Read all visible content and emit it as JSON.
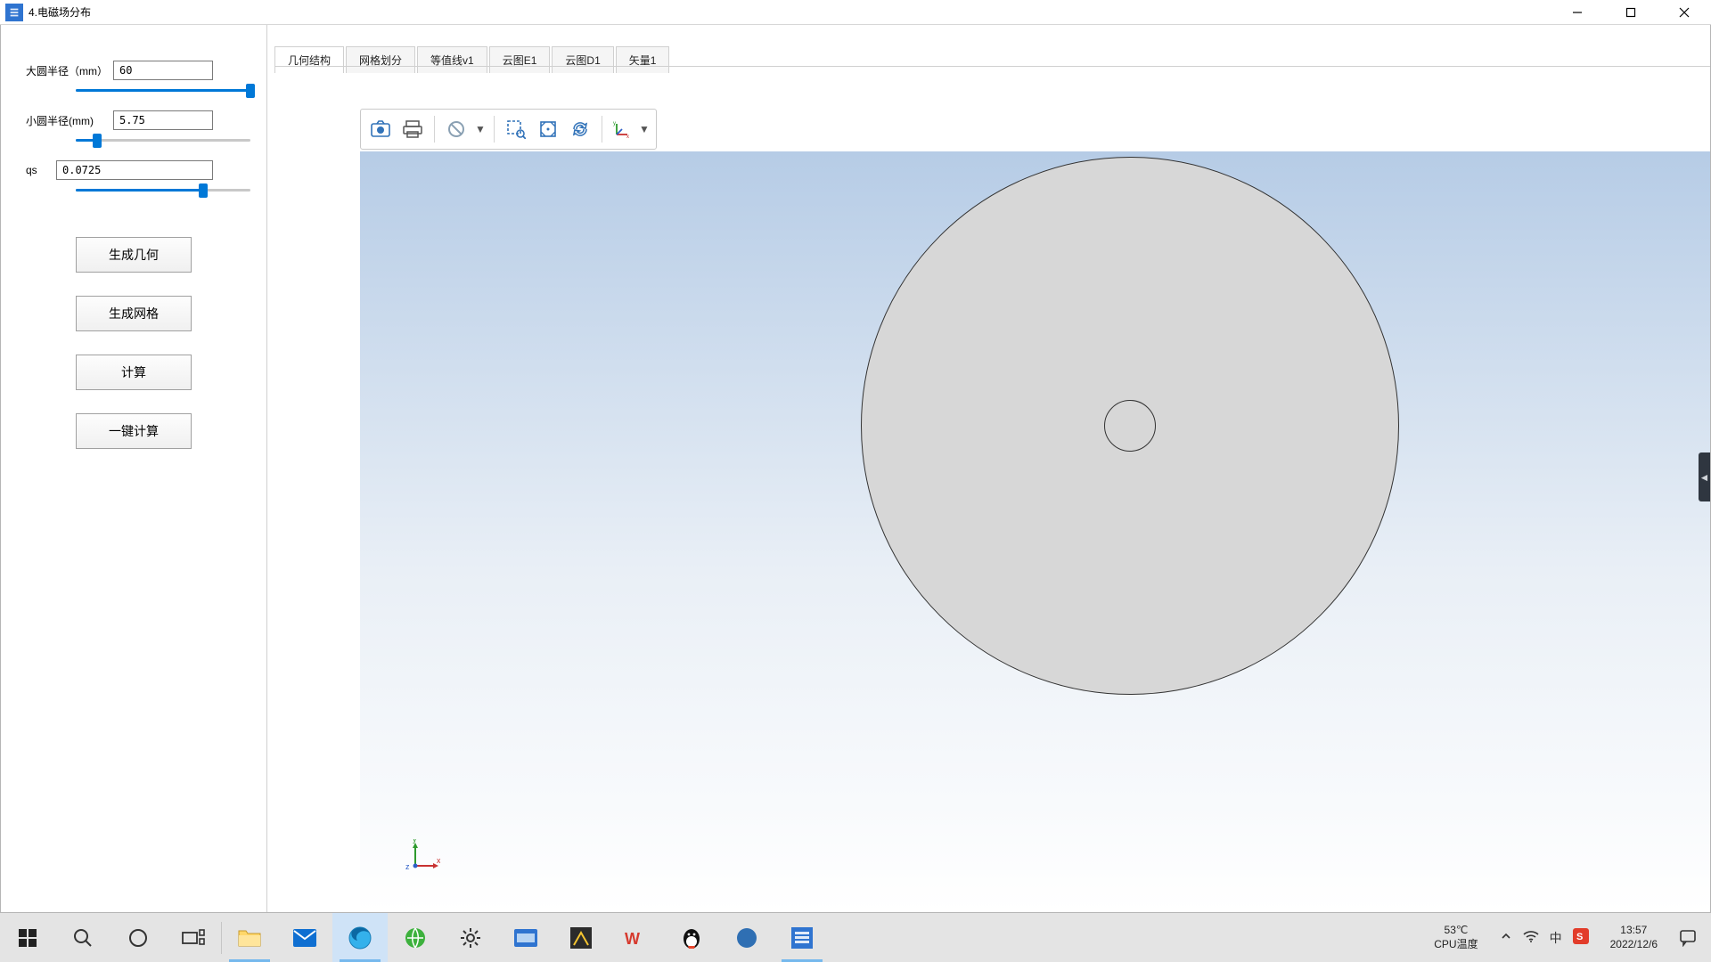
{
  "window": {
    "title": "4.电磁场分布"
  },
  "params": {
    "big_radius": {
      "label": "大圆半径（mm）",
      "value": "60",
      "slider_pct": 100
    },
    "small_radius": {
      "label": "小圆半径(mm)",
      "value": "5.75",
      "slider_pct": 12
    },
    "qs": {
      "label": "qs",
      "value": "0.0725",
      "slider_pct": 73
    }
  },
  "buttons": {
    "gen_geom": "生成几何",
    "gen_mesh": "生成网格",
    "compute": "计算",
    "one_click": "一键计算"
  },
  "tabs": [
    {
      "label": "几何结构",
      "active": true
    },
    {
      "label": "网格划分",
      "active": false
    },
    {
      "label": "等值线v1",
      "active": false
    },
    {
      "label": "云图E1",
      "active": false
    },
    {
      "label": "云图D1",
      "active": false
    },
    {
      "label": "矢量1",
      "active": false
    }
  ],
  "viewport_tools": {
    "snapshot": "snapshot-icon",
    "print": "print-icon",
    "reset": "reset-icon",
    "zoom_box": "zoom-box-icon",
    "zoom_extents": "zoom-extents-icon",
    "rotate": "rotate-arrows-icon",
    "axes": "axes-icon"
  },
  "geometry": {
    "big_circle_mm": 60,
    "small_circle_mm": 5.75
  },
  "taskbar": {
    "temp_line1": "53℃",
    "temp_line2": "CPU温度",
    "time": "13:57",
    "date": "2022/12/6"
  }
}
